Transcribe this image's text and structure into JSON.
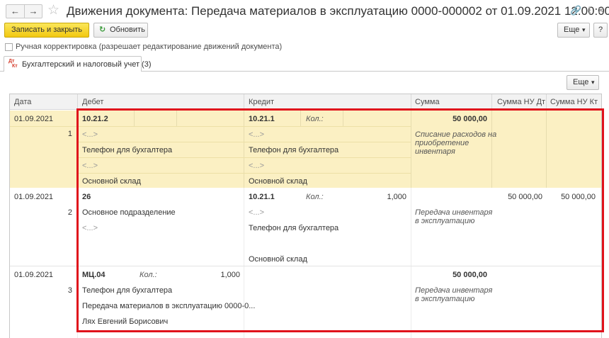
{
  "header": {
    "back_glyph": "←",
    "forward_glyph": "→",
    "star_glyph": "☆",
    "title": "Движения документа: Передача материалов в эксплуатацию 0000-000002 от 01.09.2021 12:00:00",
    "link_glyph": "🔗",
    "menu_glyph": "⋮",
    "close_glyph": "✕"
  },
  "toolbar": {
    "save_close_label": "Записать и закрыть",
    "refresh_glyph": "↻",
    "refresh_label": "Обновить",
    "more_label": "Еще",
    "more_caret": "▾",
    "help_label": "?"
  },
  "manual_edit": {
    "label": "Ручная корректировка (разрешает редактирование движений документа)",
    "checked": false
  },
  "tabs": [
    {
      "icon_top": "Дт",
      "icon_bottom": "Кт",
      "label": "Бухгалтерский и налоговый учет (3)"
    }
  ],
  "table_toolbar": {
    "more_label": "Еще",
    "more_caret": "▾"
  },
  "table": {
    "columns": [
      "Дата",
      "Дебет",
      "Кредит",
      "Сумма",
      "Сумма НУ Дт",
      "Сумма НУ Кт"
    ],
    "rows": [
      {
        "date": "01.09.2021",
        "num": "1",
        "debit": {
          "account": "10.21.2",
          "lines": [
            "<...>",
            "Телефон для бухгалтера",
            "<...>",
            "Основной склад"
          ]
        },
        "credit": {
          "account": "10.21.1",
          "qty_label": "Кол.:",
          "qty": "",
          "lines": [
            "<...>",
            "Телефон для бухгалтера",
            "<...>",
            "Основной склад"
          ]
        },
        "amount": "50 000,00",
        "content": [
          "Списание расходов на",
          "приобретение",
          "инвентаря"
        ],
        "nu_dt": "",
        "nu_kt": ""
      },
      {
        "date": "01.09.2021",
        "num": "2",
        "debit": {
          "account": "26",
          "lines": [
            "Основное подразделение",
            "<...>"
          ]
        },
        "credit": {
          "account": "10.21.1",
          "qty_label": "Кол.:",
          "qty": "1,000",
          "lines": [
            "<...>",
            "Телефон для бухгалтера",
            "Основной склад"
          ]
        },
        "amount": "",
        "content": [
          "Передача инвентаря",
          "в эксплуатацию"
        ],
        "nu_dt": "50 000,00",
        "nu_kt": "50 000,00"
      },
      {
        "date": "01.09.2021",
        "num": "3",
        "debit": {
          "account": "МЦ.04",
          "qty_label": "Кол.:",
          "qty": "1,000",
          "lines": [
            "Телефон для бухгалтера",
            "Передача материалов в эксплуатацию 0000-0...",
            "Лях Евгений Борисович"
          ]
        },
        "credit": {
          "account": "",
          "lines": []
        },
        "amount": "50 000,00",
        "content": [
          "Передача инвентаря",
          "в эксплуатацию"
        ],
        "nu_dt": "",
        "nu_kt": ""
      }
    ]
  },
  "colors": {
    "accent_yellow": "#f2c811",
    "selected_row": "#fbf0c3",
    "highlight_border": "#e0131c"
  }
}
